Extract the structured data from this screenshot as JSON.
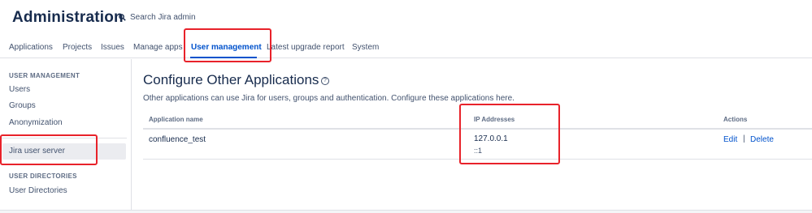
{
  "header": {
    "title": "Administration",
    "search_label": "Search Jira admin"
  },
  "tabs": [
    {
      "label": "Applications"
    },
    {
      "label": "Projects"
    },
    {
      "label": "Issues"
    },
    {
      "label": "Manage apps"
    },
    {
      "label": "User management",
      "active": true
    },
    {
      "label": "Latest upgrade report"
    },
    {
      "label": "System"
    }
  ],
  "sidebar": {
    "section1_heading": "USER MANAGEMENT",
    "items": [
      {
        "label": "Users"
      },
      {
        "label": "Groups"
      },
      {
        "label": "Anonymization"
      },
      {
        "label": "Jira user server",
        "selected": true
      }
    ],
    "section2_heading": "USER DIRECTORIES",
    "items2": [
      {
        "label": "User Directories"
      }
    ]
  },
  "main": {
    "title": "Configure Other Applications",
    "help_icon_glyph": "?",
    "description": "Other applications can use Jira for users, groups and authentication. Configure these applications here.",
    "table": {
      "headers": [
        "Application name",
        "IP Addresses",
        "Actions"
      ],
      "rows": [
        {
          "name": "confluence_test",
          "ips": [
            "127.0.0.1",
            "::1"
          ],
          "edit": "Edit",
          "separator": "|",
          "delete": "Delete"
        }
      ]
    }
  },
  "colors": {
    "accent": "#0052cc",
    "text": "#172b4d",
    "highlight_box": "#e8222a"
  }
}
